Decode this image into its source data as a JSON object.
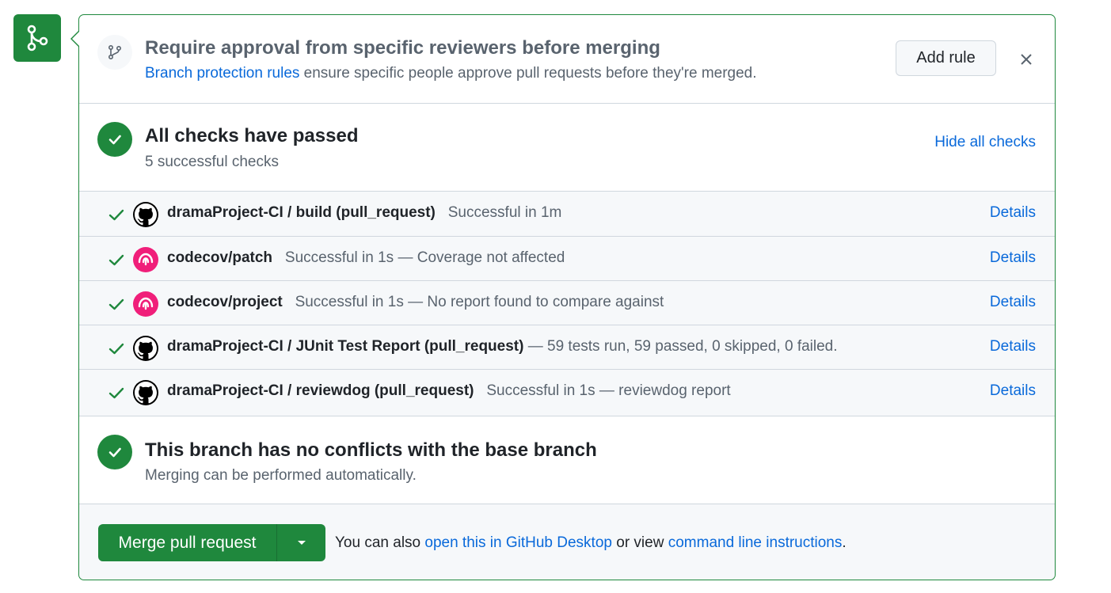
{
  "review": {
    "title": "Require approval from specific reviewers before merging",
    "link_text": "Branch protection rules",
    "description": " ensure specific people approve pull requests before they're merged.",
    "add_rule_label": "Add rule"
  },
  "checks": {
    "title": "All checks have passed",
    "subtitle": "5 successful checks",
    "hide_label": "Hide all checks",
    "items": [
      {
        "name": "dramaProject-CI / build (pull_request)",
        "desc": "Successful in 1m",
        "avatar": "github-icon",
        "details": "Details"
      },
      {
        "name": "codecov/patch",
        "desc": "Successful in 1s — Coverage not affected",
        "avatar": "codecov-icon",
        "details": "Details"
      },
      {
        "name": "codecov/project",
        "desc": "Successful in 1s — No report found to compare against",
        "avatar": "codecov-icon",
        "details": "Details"
      },
      {
        "name": "dramaProject-CI / JUnit Test Report (pull_request)",
        "desc": "— 59 tests run, 59 passed, 0 skipped, 0 failed.",
        "avatar": "github-icon",
        "details": "Details"
      },
      {
        "name": "dramaProject-CI / reviewdog (pull_request)",
        "desc": "Successful in 1s — reviewdog report",
        "avatar": "github-icon",
        "details": "Details"
      }
    ]
  },
  "conflicts": {
    "title": "This branch has no conflicts with the base branch",
    "subtitle": "Merging can be performed automatically."
  },
  "merge": {
    "button_label": "Merge pull request",
    "note_prefix": "You can also ",
    "desktop_link": "open this in GitHub Desktop",
    "note_middle": " or view ",
    "cli_link": "command line instructions",
    "note_suffix": "."
  },
  "colors": {
    "success": "#1f883d",
    "link": "#0969da",
    "codecov": "#f01f7a"
  }
}
